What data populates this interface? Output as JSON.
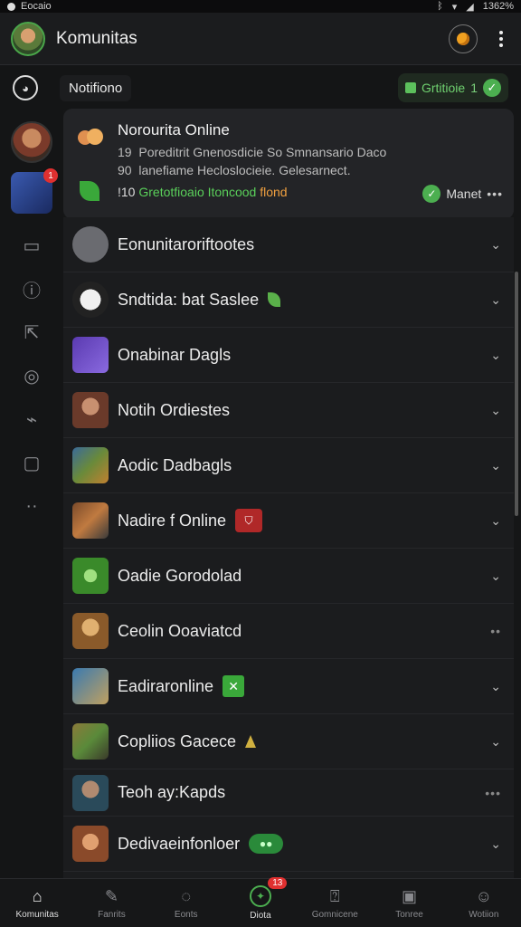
{
  "status_bar": {
    "left_text": "Eocaio",
    "right_text": "1362%"
  },
  "app_bar": {
    "title": "Komunitas"
  },
  "sub_bar": {
    "label": "Notifiono",
    "pill_text": "Grtitioie",
    "pill_num": "1"
  },
  "rail": {
    "badge": "1"
  },
  "notification": {
    "title": "Norourita Online",
    "line1_num": "19",
    "line1": "Poreditrit Gnenosdicie So Smnansario Daco",
    "line2_num": "90",
    "line2": "lanefiame Hecloslocieie. Gelesarnect.",
    "line3_num": "!10",
    "line3_green": "Gretotfioaio Itoncood",
    "line3_orange": "flond",
    "meta": "Manet"
  },
  "list": {
    "rows": [
      {
        "label": "Eonunitaroriftootes",
        "right": "chevron"
      },
      {
        "label": "Sndtida: bat Saslee",
        "right": "chevron"
      },
      {
        "label": "Onabinar Dagls",
        "right": "chevron"
      },
      {
        "label": "Notih Ordiestes",
        "right": "chevron"
      },
      {
        "label": "Aodic Dadbagls",
        "right": "chevron"
      },
      {
        "label": "Nadire f Online",
        "right": "chevron"
      },
      {
        "label": "Oadie Gorodolad",
        "right": "chevron"
      },
      {
        "label": "Ceolin Ooaviatcd",
        "right": "more"
      },
      {
        "label": "Eadiraronline",
        "right": "chevron"
      },
      {
        "label": "Copliios Gacece",
        "right": "chevron"
      },
      {
        "label": "Teoh ay:Kapds",
        "right": "more"
      },
      {
        "label": "Dedivaeinfonloer",
        "right": "chevron"
      }
    ]
  },
  "bottom_nav": {
    "tabs": [
      {
        "label": "Komunitas",
        "icon": "home-icon"
      },
      {
        "label": "Fanrits",
        "icon": "pen-icon"
      },
      {
        "label": "Eonts",
        "icon": "compass-icon"
      },
      {
        "label": "Diota",
        "icon": "game-icon",
        "badge": "13"
      },
      {
        "label": "Gomnicene",
        "icon": "chat-icon"
      },
      {
        "label": "Tonree",
        "icon": "tv-icon"
      },
      {
        "label": "Wotiion",
        "icon": "profile-icon"
      }
    ]
  },
  "colors": {
    "accent_green": "#4caf50",
    "badge_red": "#e03030",
    "coin_orange": "#f0a020"
  }
}
